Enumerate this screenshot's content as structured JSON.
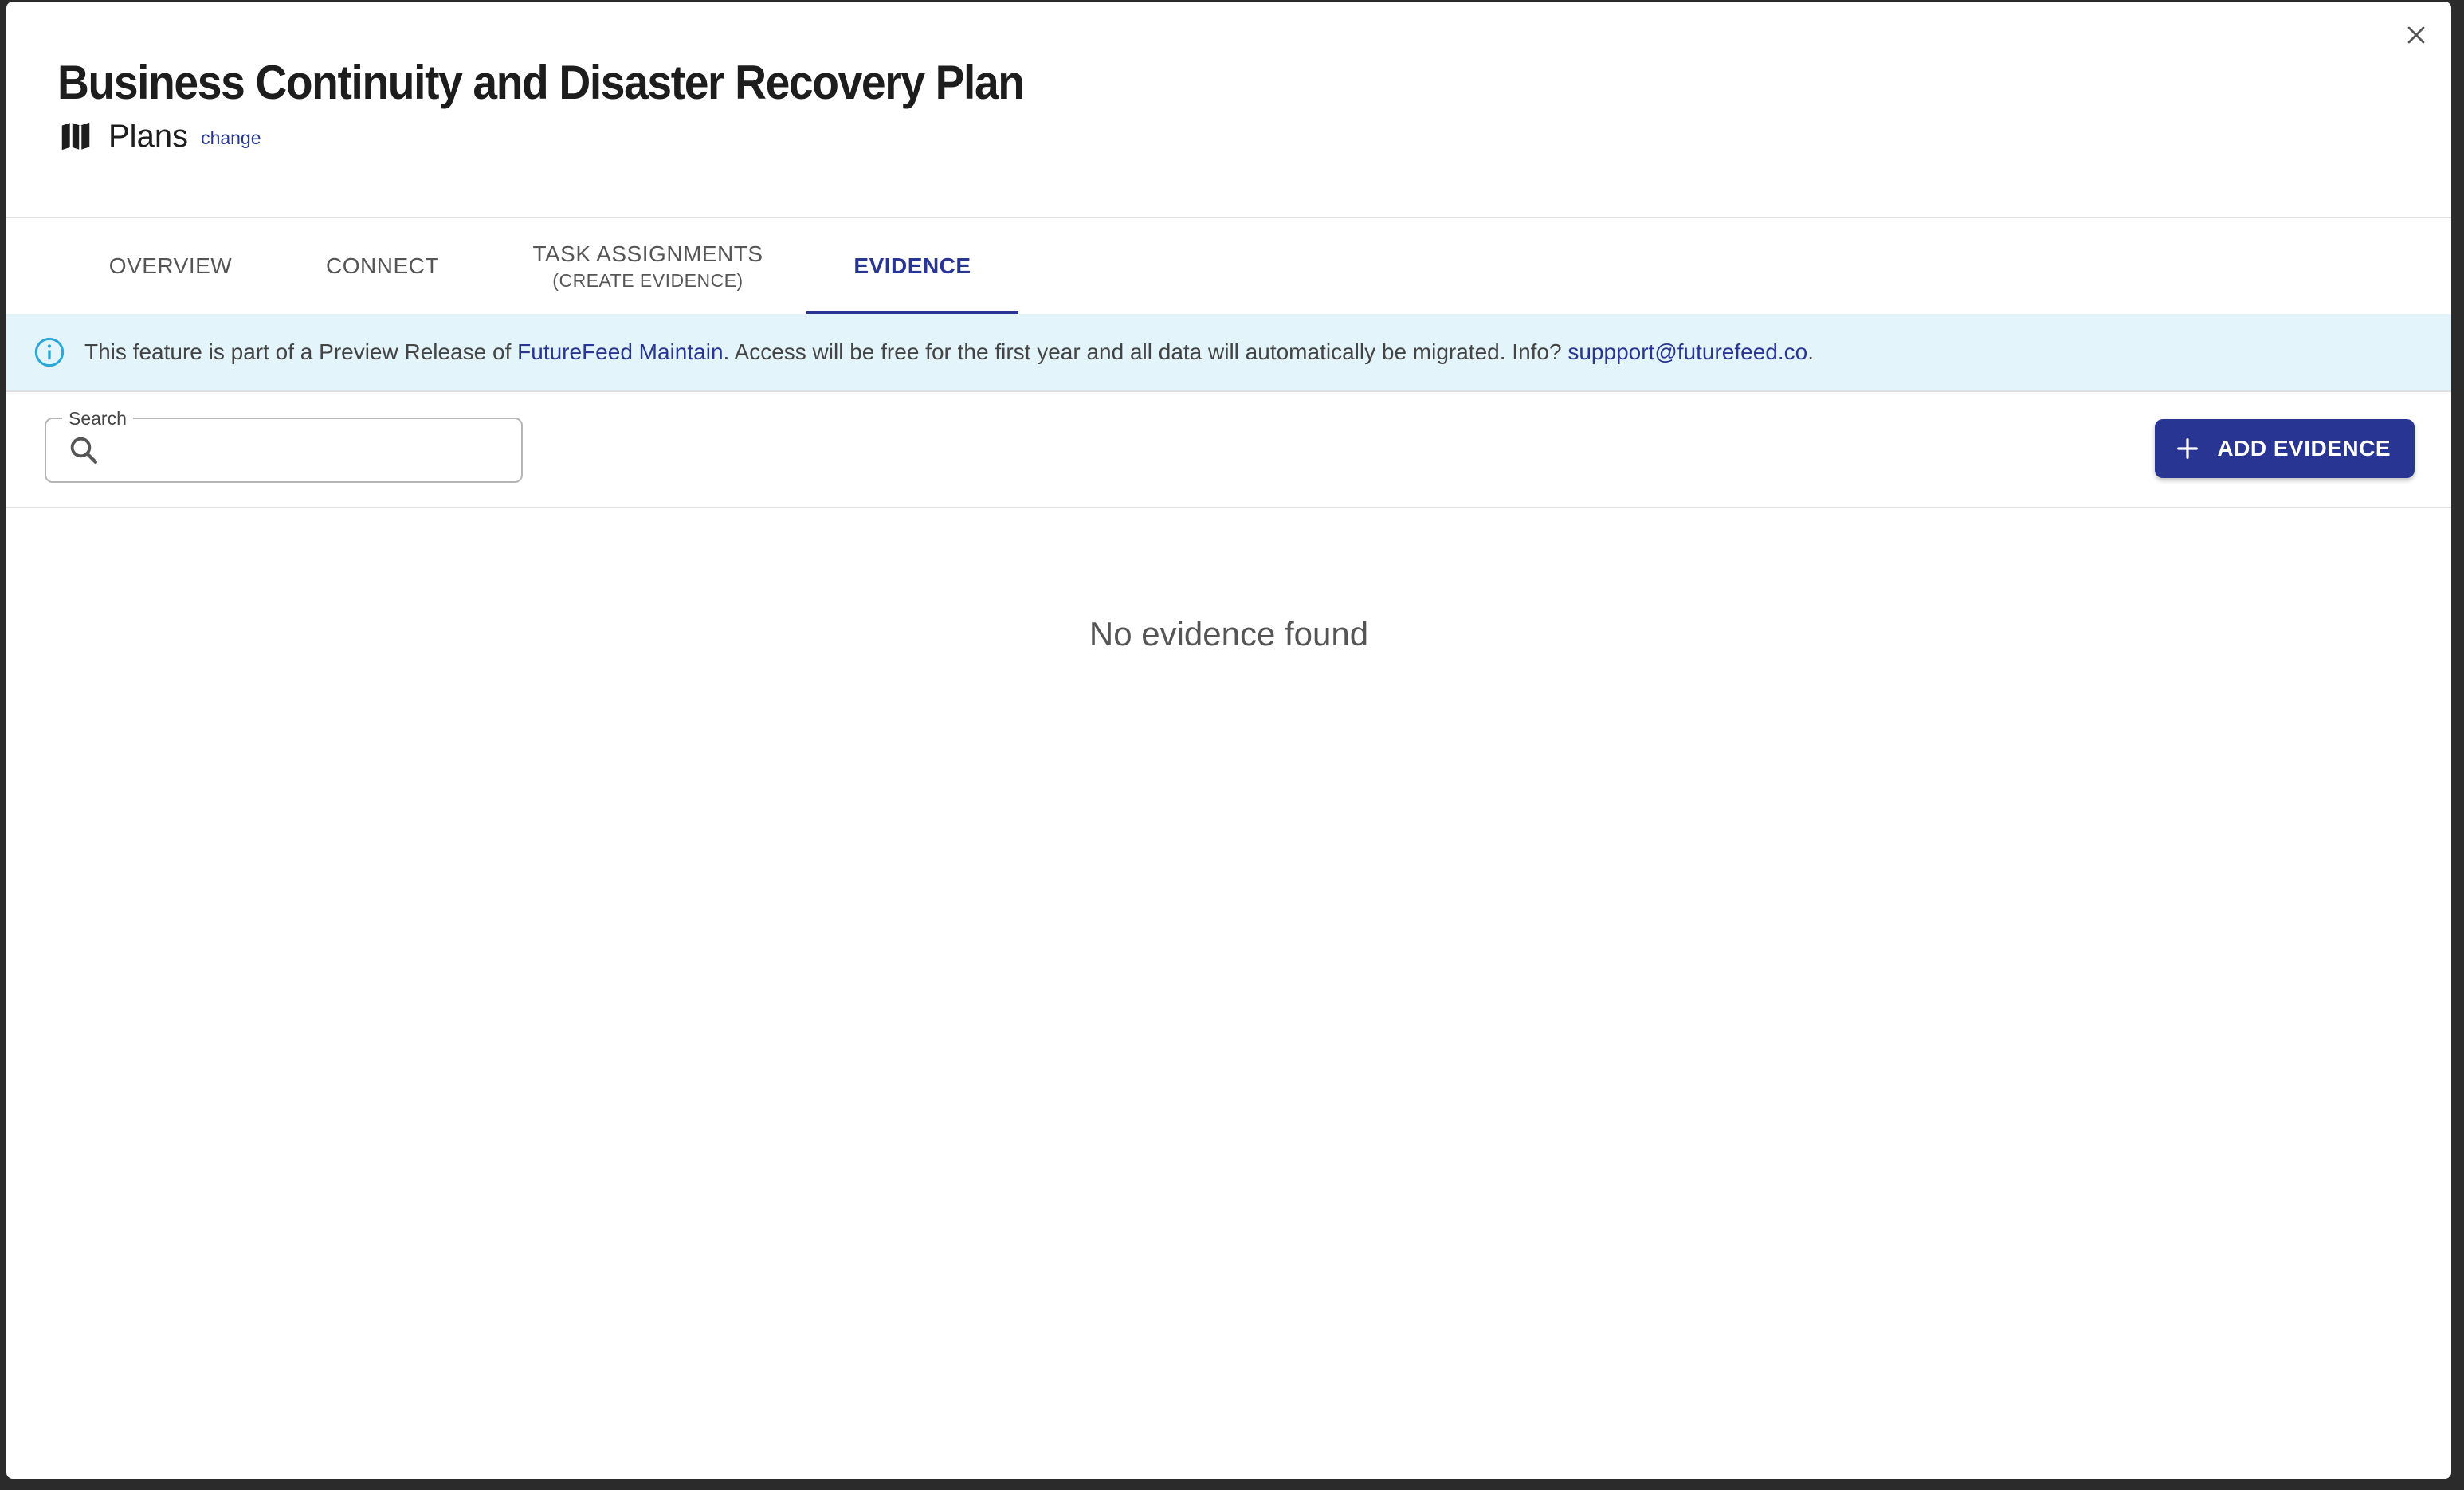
{
  "modal": {
    "title": "Business Continuity and Disaster Recovery Plan",
    "type_label": "Plans",
    "change_link": "change",
    "icons": {
      "close": "close-icon",
      "type": "map-icon"
    }
  },
  "tabs": [
    {
      "label": "OVERVIEW",
      "sub": ""
    },
    {
      "label": "CONNECT",
      "sub": ""
    },
    {
      "label": "TASK ASSIGNMENTS",
      "sub": "(CREATE EVIDENCE)"
    },
    {
      "label": "EVIDENCE",
      "sub": "",
      "active": true
    }
  ],
  "banner": {
    "text_before": "This feature is part of a Preview Release of ",
    "product_link": "FutureFeed Maintain",
    "text_middle": ". Access will be free for the first year and all data will automatically be migrated. Info? ",
    "email_link": "suppport@futurefeed.co",
    "text_after": ".",
    "icon": "info-icon"
  },
  "search": {
    "label": "Search",
    "value": "",
    "placeholder": "",
    "icon": "search-icon"
  },
  "actions": {
    "add_evidence": "ADD EVIDENCE",
    "add_icon": "plus-icon"
  },
  "empty_state": "No evidence found",
  "colors": {
    "accent": "#283593",
    "banner_bg": "#e3f4fa",
    "info_icon": "#29a8d8",
    "text": "#1d1d1d"
  }
}
